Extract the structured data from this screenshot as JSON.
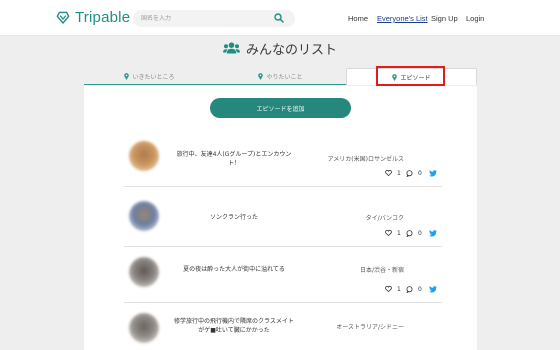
{
  "header": {
    "logo_text": "Tripable",
    "search_placeholder": "国名を入力",
    "nav": [
      {
        "label": "Home"
      },
      {
        "label": "Everyone's List"
      },
      {
        "label": "Sign Up"
      },
      {
        "label": "Login"
      }
    ]
  },
  "page": {
    "title": "みんなのリスト"
  },
  "tabs": [
    {
      "label": "いきたいところ",
      "active": false
    },
    {
      "label": "やりたいこと",
      "active": false
    },
    {
      "label": "エピソード",
      "active": true
    }
  ],
  "add_button_label": "エピソードを追加",
  "episodes": [
    {
      "title": "旅行中、友達4人(Gグループ)とエンカウント！",
      "location": "アメリカ(米国)ロサンゼルス",
      "likes": "1",
      "comments": "0"
    },
    {
      "title": "ソンクラン行った",
      "location": "タイ/バンコク",
      "likes": "1",
      "comments": "0"
    },
    {
      "title": "夏の夜は酔った大人が街中に溢れてる",
      "location": "日本/渋谷・新宿",
      "likes": "1",
      "comments": "0"
    },
    {
      "title": "修学旅行中の飛行機内で隣席のクラスメイトがゲ■吐いて臓にかかった",
      "location": "オーストラリア/シドニー",
      "likes": "1",
      "comments": "0"
    }
  ],
  "colors": {
    "brand": "#1e8f83",
    "button": "#26877c",
    "nav_active": "#1a3d8a",
    "twitter": "#1da1f2",
    "highlight": "#e21b1b"
  }
}
